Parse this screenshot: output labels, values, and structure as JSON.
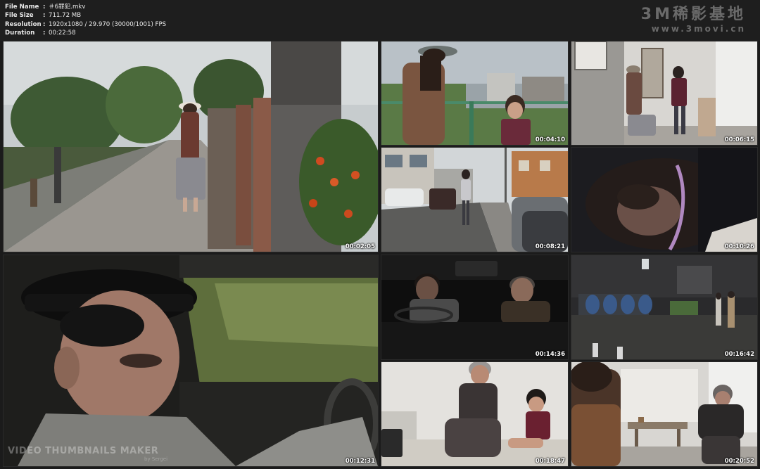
{
  "meta": {
    "rows": [
      {
        "key": "File Name",
        "sep": ":",
        "value": "＃6罪犯.mkv"
      },
      {
        "key": "File Size",
        "sep": ":",
        "value": "711.72 MB"
      },
      {
        "key": "Resolution",
        "sep": ":",
        "value": "1920x1080 / 29.970 (30000/1001) FPS"
      },
      {
        "key": "Duration",
        "sep": ":",
        "value": "00:22:58"
      }
    ]
  },
  "watermark": {
    "title": "3M稀影基地",
    "url": "www.3movi.cn"
  },
  "branding": {
    "maker": "VIDEO THUMBNAILS MAKER",
    "maker_sub": "by Sergei"
  },
  "thumbnails": [
    {
      "timestamp": "00:02:05"
    },
    {
      "timestamp": "00:04:10"
    },
    {
      "timestamp": "00:06:15"
    },
    {
      "timestamp": "00:08:21"
    },
    {
      "timestamp": "00:10:26"
    },
    {
      "timestamp": "00:12:31"
    },
    {
      "timestamp": "00:14:36"
    },
    {
      "timestamp": "00:16:42"
    },
    {
      "timestamp": "00:18:47"
    },
    {
      "timestamp": "00:20:52"
    }
  ]
}
